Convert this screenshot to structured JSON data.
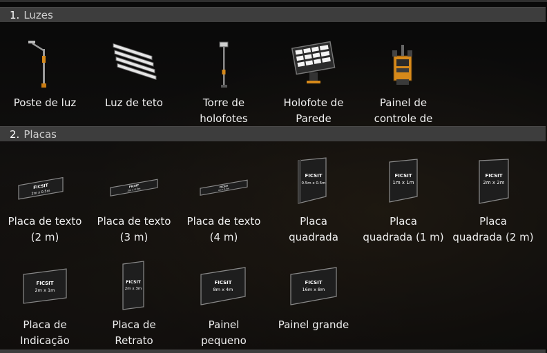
{
  "sections": [
    {
      "number": "1.",
      "title": "Luzes",
      "items": [
        {
          "label": "Poste de luz",
          "icon": "street-lamp-icon"
        },
        {
          "label": "Luz de teto",
          "icon": "ceiling-light-icon"
        },
        {
          "label": "Torre de\nholofotes",
          "icon": "floodlight-tower-icon"
        },
        {
          "label": "Holofote de\nParede",
          "icon": "wall-floodlight-icon"
        },
        {
          "label": "Painel de\ncontrole de",
          "icon": "control-panel-icon"
        }
      ]
    },
    {
      "number": "2.",
      "title": "Placas",
      "items": [
        {
          "label": "Placa de texto\n(2 m)",
          "icon": "text-sign-2m-icon",
          "sign_text": "2m x 0.5m"
        },
        {
          "label": "Placa de texto\n(3 m)",
          "icon": "text-sign-3m-icon",
          "sign_text": "3m x 0.5m"
        },
        {
          "label": "Placa de texto\n(4 m)",
          "icon": "text-sign-4m-icon",
          "sign_text": "4m x 0.5m"
        },
        {
          "label": "Placa\nquadrada",
          "icon": "square-sign-icon",
          "sign_text": "0.5m x 0.5m"
        },
        {
          "label": "Placa\nquadrada (1 m)",
          "icon": "square-sign-1m-icon",
          "sign_text": "1m x 1m"
        },
        {
          "label": "Placa\nquadrada (2 m)",
          "icon": "square-sign-2m-icon",
          "sign_text": "2m x 2m"
        },
        {
          "label": "Placa de\nIndicação",
          "icon": "label-sign-icon",
          "sign_text": "2m x 1m"
        },
        {
          "label": "Placa de\nRetrato",
          "icon": "portrait-sign-icon",
          "sign_text": "2m x 3m"
        },
        {
          "label": "Painel\npequeno",
          "icon": "small-billboard-icon",
          "sign_text": "8m x 4m"
        },
        {
          "label": "Painel grande",
          "icon": "large-billboard-icon",
          "sign_text": "16m x 8m"
        }
      ]
    }
  ],
  "sign_brand": "FICSIT",
  "colors": {
    "header_bg": "#3d3d3d",
    "text": "#f0f0f0",
    "accent": "#f29f05"
  }
}
